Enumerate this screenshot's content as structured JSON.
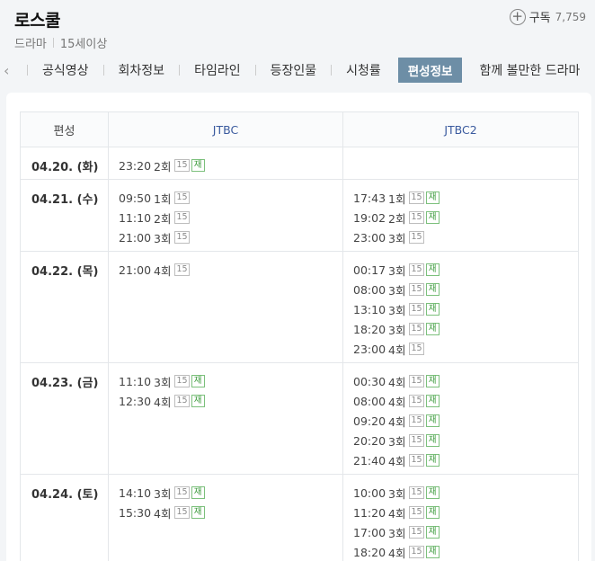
{
  "header": {
    "title": "로스쿨",
    "genre": "드라마",
    "rating": "15세이상",
    "subscribe_label": "구독",
    "subscribe_count": "7,759"
  },
  "tabs": [
    {
      "label": "공식영상",
      "active": false
    },
    {
      "label": "회차정보",
      "active": false
    },
    {
      "label": "타임라인",
      "active": false
    },
    {
      "label": "등장인물",
      "active": false
    },
    {
      "label": "시청률",
      "active": false
    },
    {
      "label": "편성정보",
      "active": true
    },
    {
      "label": "함께 볼만한 드라마",
      "active": false
    }
  ],
  "table": {
    "headers": [
      "편성",
      "JTBC",
      "JTBC2"
    ],
    "rows": [
      {
        "date": "04.20. (화)",
        "jtbc": [
          {
            "time": "23:20",
            "ep": "2회",
            "age": "15",
            "rerun": "재"
          }
        ],
        "jtbc2": []
      },
      {
        "date": "04.21. (수)",
        "jtbc": [
          {
            "time": "09:50",
            "ep": "1회",
            "age": "15",
            "rerun": ""
          },
          {
            "time": "11:10",
            "ep": "2회",
            "age": "15",
            "rerun": ""
          },
          {
            "time": "21:00",
            "ep": "3회",
            "age": "15",
            "rerun": ""
          }
        ],
        "jtbc2": [
          {
            "time": "17:43",
            "ep": "1회",
            "age": "15",
            "rerun": "재"
          },
          {
            "time": "19:02",
            "ep": "2회",
            "age": "15",
            "rerun": "재"
          },
          {
            "time": "23:00",
            "ep": "3회",
            "age": "15",
            "rerun": ""
          }
        ]
      },
      {
        "date": "04.22. (목)",
        "jtbc": [
          {
            "time": "21:00",
            "ep": "4회",
            "age": "15",
            "rerun": ""
          }
        ],
        "jtbc2": [
          {
            "time": "00:17",
            "ep": "3회",
            "age": "15",
            "rerun": "재"
          },
          {
            "time": "08:00",
            "ep": "3회",
            "age": "15",
            "rerun": "재"
          },
          {
            "time": "13:10",
            "ep": "3회",
            "age": "15",
            "rerun": "재"
          },
          {
            "time": "18:20",
            "ep": "3회",
            "age": "15",
            "rerun": "재"
          },
          {
            "time": "23:00",
            "ep": "4회",
            "age": "15",
            "rerun": ""
          }
        ]
      },
      {
        "date": "04.23. (금)",
        "jtbc": [
          {
            "time": "11:10",
            "ep": "3회",
            "age": "15",
            "rerun": "재"
          },
          {
            "time": "12:30",
            "ep": "4회",
            "age": "15",
            "rerun": "재"
          }
        ],
        "jtbc2": [
          {
            "time": "00:30",
            "ep": "4회",
            "age": "15",
            "rerun": "재"
          },
          {
            "time": "08:00",
            "ep": "4회",
            "age": "15",
            "rerun": "재"
          },
          {
            "time": "09:20",
            "ep": "4회",
            "age": "15",
            "rerun": "재"
          },
          {
            "time": "20:20",
            "ep": "3회",
            "age": "15",
            "rerun": "재"
          },
          {
            "time": "21:40",
            "ep": "4회",
            "age": "15",
            "rerun": "재"
          }
        ]
      },
      {
        "date": "04.24. (토)",
        "jtbc": [
          {
            "time": "14:10",
            "ep": "3회",
            "age": "15",
            "rerun": "재"
          },
          {
            "time": "15:30",
            "ep": "4회",
            "age": "15",
            "rerun": "재"
          }
        ],
        "jtbc2": [
          {
            "time": "10:00",
            "ep": "3회",
            "age": "15",
            "rerun": "재"
          },
          {
            "time": "11:20",
            "ep": "4회",
            "age": "15",
            "rerun": "재"
          },
          {
            "time": "17:00",
            "ep": "3회",
            "age": "15",
            "rerun": "재"
          },
          {
            "time": "18:20",
            "ep": "4회",
            "age": "15",
            "rerun": "재"
          }
        ]
      }
    ]
  },
  "colors": {
    "active_tab": "#6d8ea6",
    "channel_header": "#3a5a9e",
    "rerun_badge": "#3b9a3b"
  }
}
